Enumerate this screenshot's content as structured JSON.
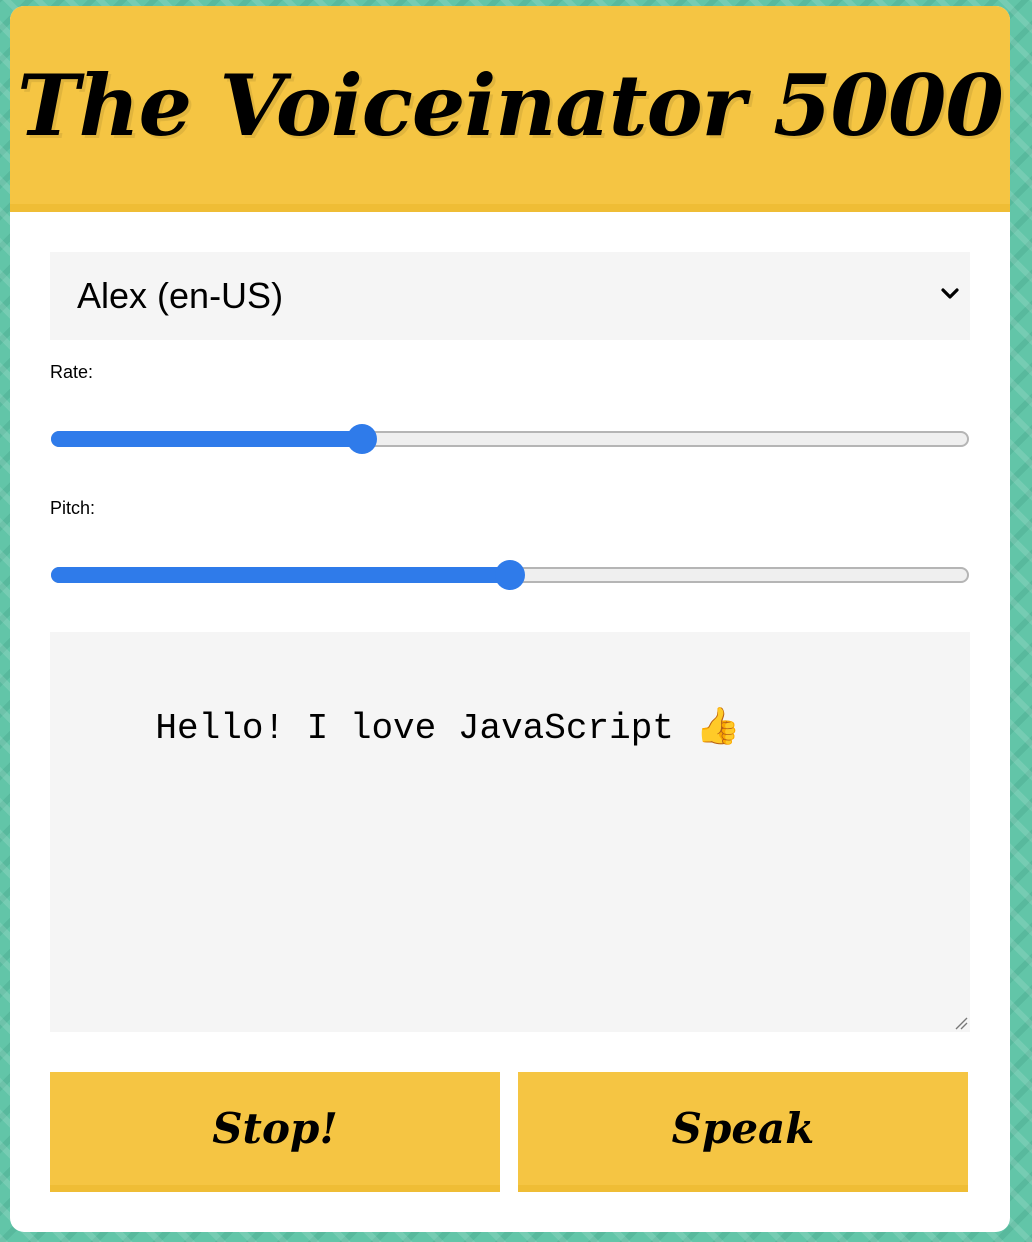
{
  "app": {
    "title": "The Voiceinator 5000"
  },
  "voice_select": {
    "selected": "Alex (en-US)",
    "icon": "chevron-down-icon"
  },
  "rate": {
    "label": "Rate:",
    "value": 1,
    "min": 0,
    "max": 3
  },
  "pitch": {
    "label": "Pitch:",
    "value": 1,
    "min": 0,
    "max": 2
  },
  "message": {
    "text": "Hello! I love JavaScript 👍"
  },
  "buttons": {
    "stop_label": "Stop!",
    "speak_label": "Speak"
  },
  "colors": {
    "accent_yellow": "#f5c543",
    "slider_blue": "#2f7bea",
    "background_teal": "#62c5a8"
  }
}
